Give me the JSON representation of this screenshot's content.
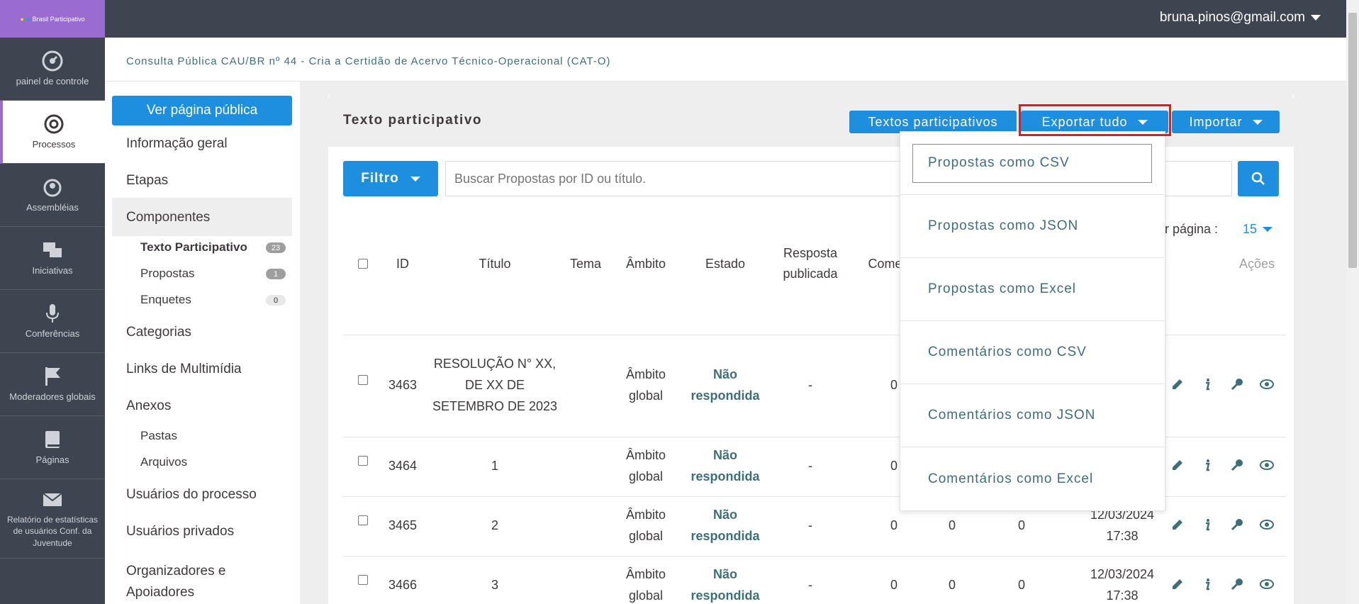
{
  "brand": {
    "logo_text": "Brasil Participativo"
  },
  "user": {
    "email": "bruna.pinos@gmail.com"
  },
  "leftnav": [
    {
      "label": "painel de controle",
      "icon": "dashboard-icon"
    },
    {
      "label": "Processos",
      "icon": "target-icon",
      "active": true
    },
    {
      "label": "Assembléias",
      "icon": "assembly-icon"
    },
    {
      "label": "Iniciativas",
      "icon": "chat-icon"
    },
    {
      "label": "Conferências",
      "icon": "microphone-icon"
    },
    {
      "label": "Moderadores globais",
      "icon": "flag-icon"
    },
    {
      "label": "Páginas",
      "icon": "book-icon"
    },
    {
      "label": "Relatório de estatísticas de usuários Conf. da Juventude",
      "icon": "envelope-icon"
    }
  ],
  "page_title": "Consulta Pública CAU/BR nº 44 - Cria a Certidão de Acervo Técnico-Operacional (CAT-O)",
  "sidebar": {
    "public_button": "Ver página pública",
    "info": "Informação geral",
    "steps": "Etapas",
    "components": "Componentes",
    "comp_items": [
      {
        "label": "Texto Participativo",
        "count": "23"
      },
      {
        "label": "Propostas",
        "count": "1"
      },
      {
        "label": "Enquetes",
        "count": "0"
      }
    ],
    "categories": "Categorias",
    "media_links": "Links de Multimídia",
    "attachments": "Anexos",
    "folders": "Pastas",
    "files": "Arquivos",
    "process_users": "Usuários do processo",
    "private_users": "Usuários privados",
    "organizers": "Organizadores e Apoiadores"
  },
  "card": {
    "title": "Texto participativo",
    "btn_texts": "Textos participativos",
    "btn_export": "Exportar tudo",
    "btn_import": "Importar"
  },
  "filter": {
    "button": "Filtro",
    "search_placeholder": "Buscar Propostas por ID ou título.",
    "per_page_label": "or página :",
    "per_page_value": "15"
  },
  "table": {
    "headers": {
      "id": "ID",
      "title": "Título",
      "theme": "Tema",
      "scope": "Âmbito",
      "state": "Estado",
      "answer": "Resposta publicada",
      "comments": "Comenta",
      "actions": "Ações"
    },
    "rows": [
      {
        "id": "3463",
        "title": "RESOLUÇÃO N° XX, DE XX DE SETEMBRO DE 2023",
        "scope": "Âmbito global",
        "state": "Não respondida",
        "answer": "-",
        "c1": "0",
        "c2": "",
        "c3": "",
        "date": ""
      },
      {
        "id": "3464",
        "title": "1",
        "scope": "Âmbito global",
        "state": "Não respondida",
        "answer": "-",
        "c1": "0",
        "c2": "",
        "c3": "",
        "date": ""
      },
      {
        "id": "3465",
        "title": "2",
        "scope": "Âmbito global",
        "state": "Não respondida",
        "answer": "-",
        "c1": "0",
        "c2": "0",
        "c3": "0",
        "date": "12/03/2024 17:38"
      },
      {
        "id": "3466",
        "title": "3",
        "scope": "Âmbito global",
        "state": "Não respondida",
        "answer": "-",
        "c1": "0",
        "c2": "0",
        "c3": "0",
        "date": "12/03/2024 17:38"
      }
    ]
  },
  "export_menu": [
    "Propostas como CSV",
    "Propostas como JSON",
    "Propostas como Excel",
    "Comentários como CSV",
    "Comentários como JSON",
    "Comentários como Excel"
  ],
  "colors": {
    "primary": "#1e8fde",
    "nav_bg": "#3e4450",
    "brand": "#9a6bd0",
    "highlight": "#e21b1b",
    "link_teal": "#3d6e7a"
  }
}
